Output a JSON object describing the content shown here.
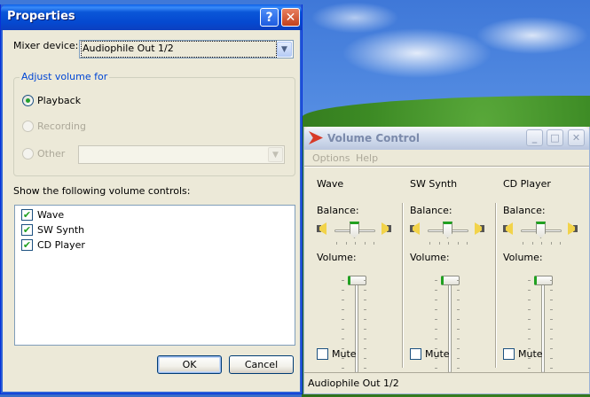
{
  "properties": {
    "title": "Properties",
    "help_glyph": "?",
    "close_glyph": "✕",
    "mixer_label": "Mixer device:",
    "mixer_value": "Audiophile Out 1/2",
    "group_label": "Adjust volume for",
    "radios": [
      {
        "label": "Playback",
        "selected": true,
        "enabled": true
      },
      {
        "label": "Recording",
        "selected": false,
        "enabled": false
      },
      {
        "label": "Other",
        "selected": false,
        "enabled": false
      }
    ],
    "other_value": "",
    "show_label": "Show the following volume controls:",
    "controls": [
      {
        "label": "Wave",
        "checked": true
      },
      {
        "label": "SW Synth",
        "checked": true
      },
      {
        "label": "CD Player",
        "checked": true
      }
    ],
    "ok_label": "OK",
    "cancel_label": "Cancel"
  },
  "volume_control": {
    "title": "Volume Control",
    "menu": [
      "Options",
      "Help"
    ],
    "minimize_glyph": "_",
    "maximize_glyph": "□",
    "close_glyph": "✕",
    "balance_label": "Balance:",
    "volume_label": "Volume:",
    "mute_label": "Mute",
    "channels": [
      {
        "name": "Wave",
        "balance": 0.5,
        "volume": 1.0,
        "muted": false
      },
      {
        "name": "SW Synth",
        "balance": 0.5,
        "volume": 1.0,
        "muted": false
      },
      {
        "name": "CD Player",
        "balance": 0.5,
        "volume": 1.0,
        "muted": false
      }
    ],
    "status": "Audiophile Out 1/2"
  },
  "colors": {
    "accent_green": "#21a121",
    "title_blue": "#0549d0"
  }
}
